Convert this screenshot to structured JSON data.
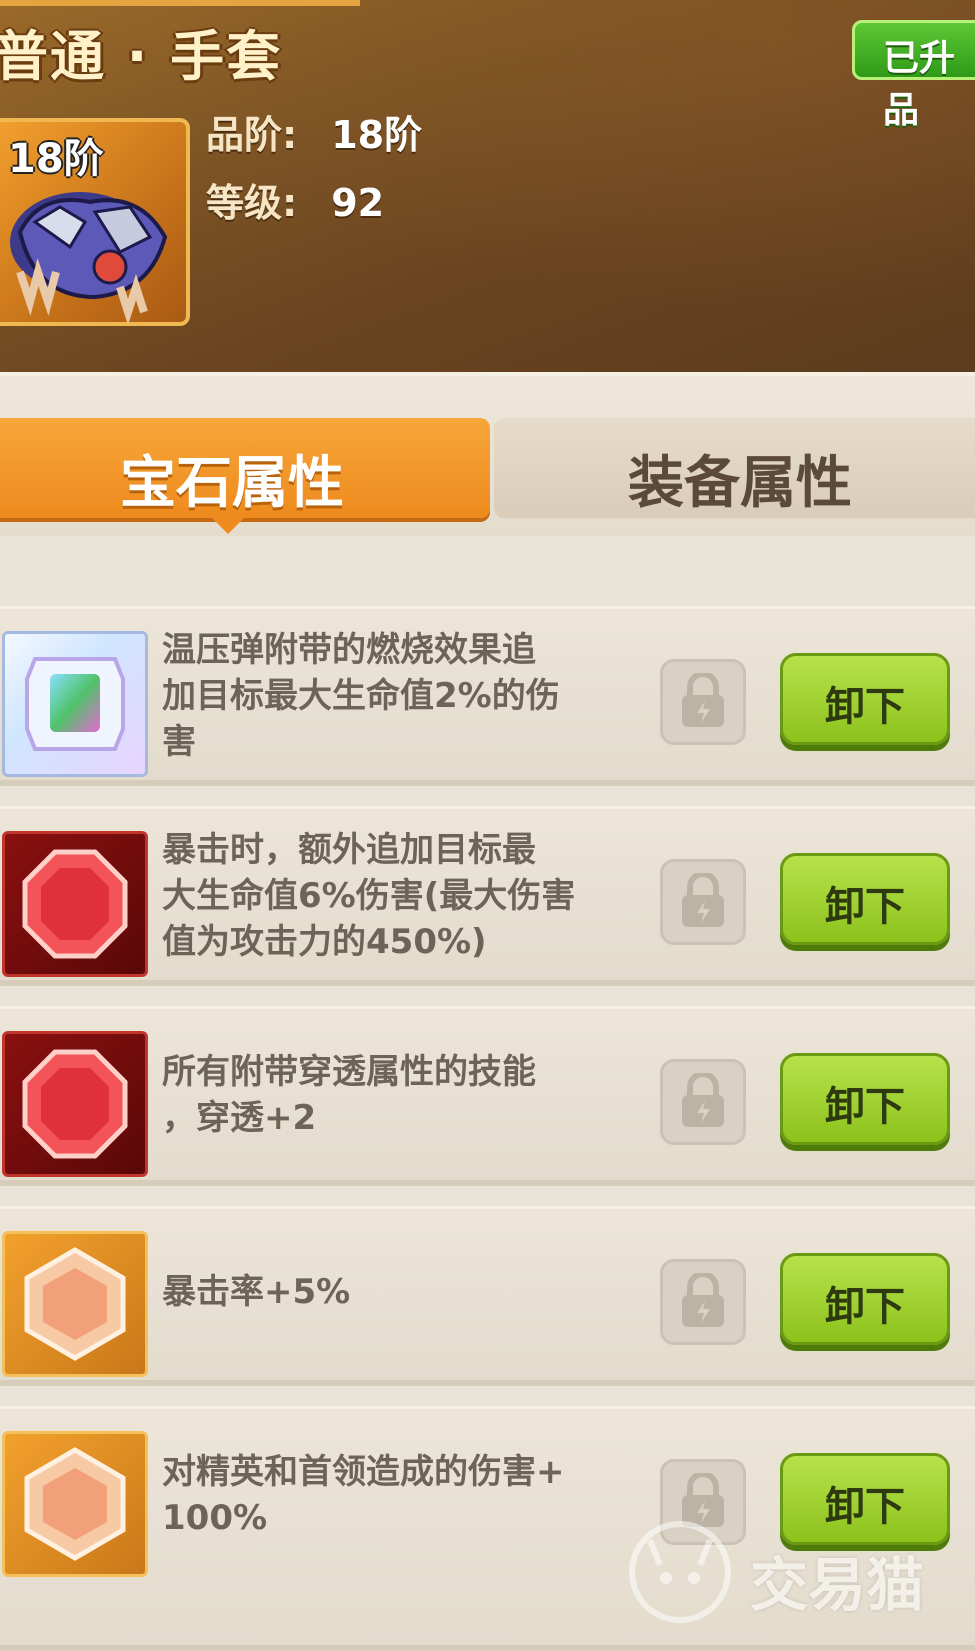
{
  "header": {
    "title": "普通 · 手套",
    "upgraded_badge": "已升品",
    "tier_overlay": "18阶",
    "quality_label": "品阶:",
    "quality_value": "18阶",
    "level_label": "等级:",
    "level_value": "92"
  },
  "tabs": [
    {
      "label": "宝石属性",
      "active": true
    },
    {
      "label": "装备属性",
      "active": false
    }
  ],
  "gems": [
    {
      "icon": "rainbow-gem-icon",
      "desc": "温压弹附带的燃烧效果追\n加目标最大生命值2%的伤\n害",
      "button": "卸下"
    },
    {
      "icon": "red-gem-icon",
      "desc": "暴击时，额外追加目标最\n大生命值6%伤害(最大伤害\n值为攻击力的450%)",
      "button": "卸下"
    },
    {
      "icon": "red-gem-icon",
      "desc": "所有附带穿透属性的技能\n，穿透+2",
      "button": "卸下"
    },
    {
      "icon": "orange-gem-icon",
      "desc": "暴击率+5%",
      "button": "卸下"
    },
    {
      "icon": "orange-gem-icon",
      "desc": "对精英和首领造成的伤害+\n100%",
      "button": "卸下"
    }
  ],
  "watermark": "交易猫",
  "colors": {
    "tab_active": "#ee8a1e",
    "button_green": "#8cc21c",
    "badge_green": "#3fae22"
  }
}
